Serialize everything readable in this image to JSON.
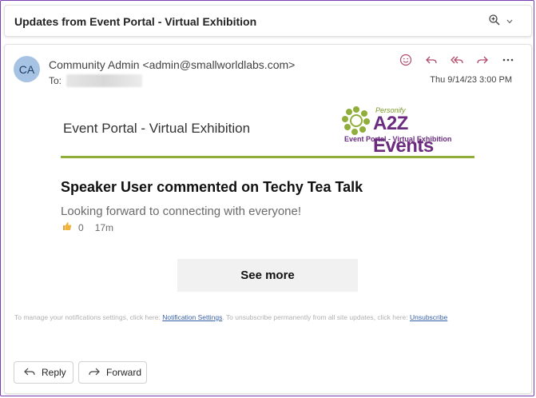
{
  "subject": "Updates from Event Portal - Virtual Exhibition",
  "icons": {
    "zoom": "zoom-in-icon",
    "chevron": "chevron-down-icon"
  },
  "email": {
    "avatar_initials": "CA",
    "sender": "Community Admin <admin@smallworldlabs.com>",
    "to_label": "To:",
    "date": "Thu 9/14/23 3:00 PM",
    "actions": [
      "emoji-icon",
      "reply-icon",
      "reply-all-icon",
      "forward-icon",
      "more-icon"
    ]
  },
  "banner": {
    "title": "Event Portal - Virtual Exhibition",
    "logo": {
      "personify": "Personify",
      "brand": "A2Z Events",
      "subtitle": "Event Portal - Virtual Exhibition"
    }
  },
  "post": {
    "title": "Speaker User commented on Techy Tea Talk",
    "body": "Looking forward to connecting with everyone!",
    "likes": "0",
    "age": "17m"
  },
  "see_more_label": "See more",
  "footer": {
    "text_before": "To manage your notifications settings, click here: ",
    "settings_link": "Notification Settings",
    "text_middle": ". To unsubscribe permanently from all site updates, click here: ",
    "unsubscribe_link": "Unsubscribe"
  },
  "buttons": {
    "reply": "Reply",
    "forward": "Forward"
  },
  "colors": {
    "frame": "#7a3fb3",
    "accent_green": "#8fae3a",
    "brand_purple": "#6b2c7f",
    "action_pink": "#b14a6a"
  }
}
